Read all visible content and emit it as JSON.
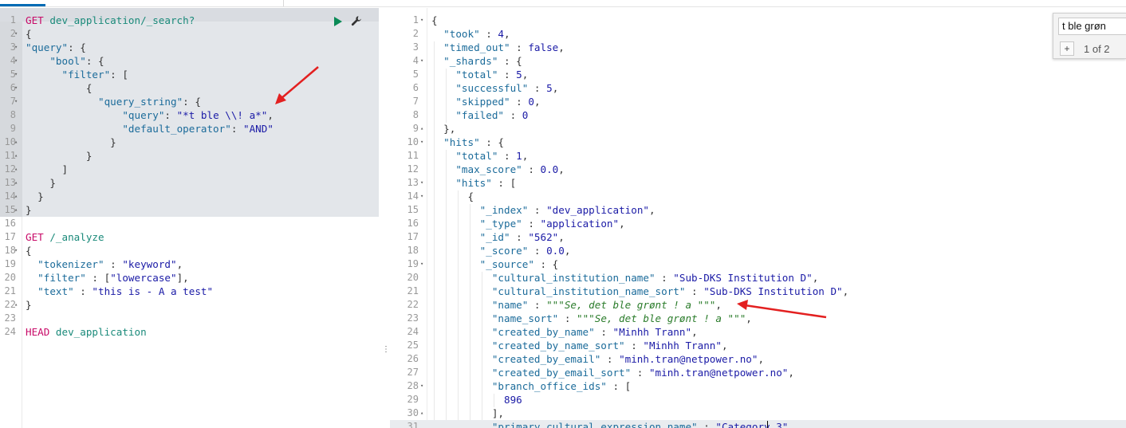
{
  "colors": {
    "accent": "#006bb4",
    "play": "#0a8a56",
    "arrow": "#e32020",
    "method": "#c80a68",
    "url": "#1a8a7a",
    "key": "#1b6b9a",
    "string": "#1a1aa6"
  },
  "icons": {
    "run": "play-icon",
    "settings": "wrench-icon"
  },
  "left": {
    "r1": {
      "ln": "1",
      "method": "GET",
      "url": " dev_application/_search?"
    },
    "r2": {
      "ln": "2",
      "text": "{"
    },
    "r3": {
      "ln": "3",
      "key": "\"query\"",
      "rest": ": {"
    },
    "r4": {
      "ln": "4",
      "ind": "    ",
      "key": "\"bool\"",
      "rest": ": {"
    },
    "r5": {
      "ln": "5",
      "ind": "      ",
      "key": "\"filter\"",
      "rest": ": ["
    },
    "r6": {
      "ln": "6",
      "text": "          {"
    },
    "r7": {
      "ln": "7",
      "ind": "            ",
      "key": "\"query_string\"",
      "rest": ": {"
    },
    "r8": {
      "ln": "8",
      "ind": "                ",
      "key": "\"query\"",
      "sep": ": ",
      "val": "\"*t ble \\\\! a*\"",
      "rest": ","
    },
    "r9": {
      "ln": "9",
      "ind": "                ",
      "key": "\"default_operator\"",
      "sep": ": ",
      "val": "\"AND\""
    },
    "r10": {
      "ln": "10",
      "text": "              }"
    },
    "r11": {
      "ln": "11",
      "text": "          }"
    },
    "r12": {
      "ln": "12",
      "text": "      ]"
    },
    "r13": {
      "ln": "13",
      "text": "    }"
    },
    "r14": {
      "ln": "14",
      "text": "  }"
    },
    "r15": {
      "ln": "15",
      "text": "}"
    },
    "r16": {
      "ln": "16",
      "text": ""
    },
    "r17": {
      "ln": "17",
      "method": "GET",
      "url": " /_analyze"
    },
    "r18": {
      "ln": "18",
      "text": "{"
    },
    "r19": {
      "ln": "19",
      "ind": "  ",
      "key": "\"tokenizer\"",
      "sep": " : ",
      "val": "\"keyword\"",
      "rest": ","
    },
    "r20": {
      "ln": "20",
      "ind": "  ",
      "key": "\"filter\"",
      "sep": " : [",
      "val": "\"lowercase\"",
      "rest": "],"
    },
    "r21": {
      "ln": "21",
      "ind": "  ",
      "key": "\"text\"",
      "sep": " : ",
      "val": "\"this is - A a test\""
    },
    "r22": {
      "ln": "22",
      "text": "}"
    },
    "r23": {
      "ln": "23",
      "text": ""
    },
    "r24": {
      "ln": "24",
      "method": "HEAD",
      "url": " dev_application"
    }
  },
  "right": {
    "r1": {
      "ln": "1",
      "text": "{"
    },
    "r2": {
      "ln": "2",
      "ind": "  ",
      "key": "\"took\"",
      "sep": " : ",
      "val": "4",
      "rest": ","
    },
    "r3": {
      "ln": "3",
      "ind": "  ",
      "key": "\"timed_out\"",
      "sep": " : ",
      "val": "false",
      "rest": ","
    },
    "r4": {
      "ln": "4",
      "ind": "  ",
      "key": "\"_shards\"",
      "rest": " : {"
    },
    "r5": {
      "ln": "5",
      "ind": "    ",
      "key": "\"total\"",
      "sep": " : ",
      "val": "5",
      "rest": ","
    },
    "r6": {
      "ln": "6",
      "ind": "    ",
      "key": "\"successful\"",
      "sep": " : ",
      "val": "5",
      "rest": ","
    },
    "r7": {
      "ln": "7",
      "ind": "    ",
      "key": "\"skipped\"",
      "sep": " : ",
      "val": "0",
      "rest": ","
    },
    "r8": {
      "ln": "8",
      "ind": "    ",
      "key": "\"failed\"",
      "sep": " : ",
      "val": "0"
    },
    "r9": {
      "ln": "9",
      "text": "  },"
    },
    "r10": {
      "ln": "10",
      "ind": "  ",
      "key": "\"hits\"",
      "rest": " : {"
    },
    "r11": {
      "ln": "11",
      "ind": "    ",
      "key": "\"total\"",
      "sep": " : ",
      "val": "1",
      "rest": ","
    },
    "r12": {
      "ln": "12",
      "ind": "    ",
      "key": "\"max_score\"",
      "sep": " : ",
      "val": "0.0",
      "rest": ","
    },
    "r13": {
      "ln": "13",
      "ind": "    ",
      "key": "\"hits\"",
      "rest": " : ["
    },
    "r14": {
      "ln": "14",
      "text": "      {"
    },
    "r15": {
      "ln": "15",
      "ind": "        ",
      "key": "\"_index\"",
      "sep": " : ",
      "val": "\"dev_application\"",
      "rest": ","
    },
    "r16": {
      "ln": "16",
      "ind": "        ",
      "key": "\"_type\"",
      "sep": " : ",
      "val": "\"application\"",
      "rest": ","
    },
    "r17": {
      "ln": "17",
      "ind": "        ",
      "key": "\"_id\"",
      "sep": " : ",
      "val": "\"562\"",
      "rest": ","
    },
    "r18": {
      "ln": "18",
      "ind": "        ",
      "key": "\"_score\"",
      "sep": " : ",
      "val": "0.0",
      "rest": ","
    },
    "r19": {
      "ln": "19",
      "ind": "        ",
      "key": "\"_source\"",
      "rest": " : {"
    },
    "r20": {
      "ln": "20",
      "ind": "          ",
      "key": "\"cultural_institution_name\"",
      "sep": " : ",
      "val": "\"Sub-DKS Institution D\"",
      "rest": ","
    },
    "r21": {
      "ln": "21",
      "ind": "          ",
      "key": "\"cultural_institution_name_sort\"",
      "sep": " : ",
      "val": "\"Sub-DKS Institution D\"",
      "rest": ","
    },
    "r22": {
      "ln": "22",
      "ind": "          ",
      "key": "\"name\"",
      "sep": " : ",
      "val": "\"\"\"Se, det ble grønt ! a \"\"\"",
      "rest": ","
    },
    "r23": {
      "ln": "23",
      "ind": "          ",
      "key": "\"name_sort\"",
      "sep": " : ",
      "val": "\"\"\"Se, det ble grønt ! a \"\"\"",
      "rest": ","
    },
    "r24": {
      "ln": "24",
      "ind": "          ",
      "key": "\"created_by_name\"",
      "sep": " : ",
      "val": "\"Minhh Trann\"",
      "rest": ","
    },
    "r25": {
      "ln": "25",
      "ind": "          ",
      "key": "\"created_by_name_sort\"",
      "sep": " : ",
      "val": "\"Minhh Trann\"",
      "rest": ","
    },
    "r26": {
      "ln": "26",
      "ind": "          ",
      "key": "\"created_by_email\"",
      "sep": " : ",
      "val": "\"minh.tran@netpower.no\"",
      "rest": ","
    },
    "r27": {
      "ln": "27",
      "ind": "          ",
      "key": "\"created_by_email_sort\"",
      "sep": " : ",
      "val": "\"minh.tran@netpower.no\"",
      "rest": ","
    },
    "r28": {
      "ln": "28",
      "ind": "          ",
      "key": "\"branch_office_ids\"",
      "rest": " : ["
    },
    "r29": {
      "ln": "29",
      "ind": "            ",
      "val": "896"
    },
    "r30": {
      "ln": "30",
      "text": "          ],"
    },
    "r31": {
      "ln": "31",
      "ind": "          ",
      "key": "\"primary_cultural_expression_name\"",
      "sep": " : ",
      "val": "\"Category 3\""
    }
  },
  "search": {
    "value": "t ble grøn",
    "plus": "+",
    "count": "1 of 2"
  },
  "divider_glyph": "⋮"
}
